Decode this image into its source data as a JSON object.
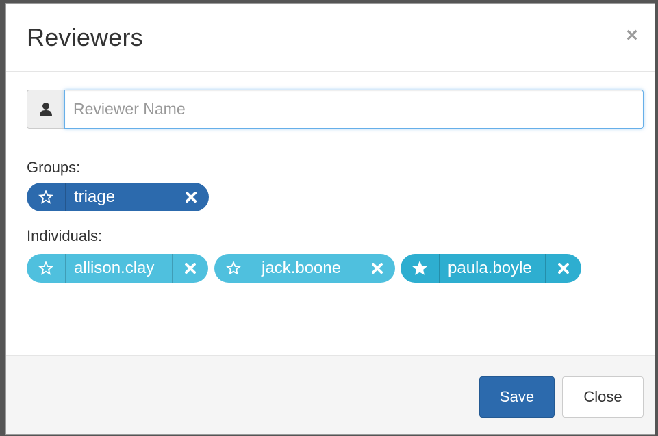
{
  "dialog": {
    "title": "Reviewers",
    "close_glyph": "×"
  },
  "search": {
    "placeholder": "Reviewer Name",
    "value": "",
    "icon": "user-icon"
  },
  "groups": {
    "label": "Groups:",
    "items": [
      {
        "name": "triage",
        "starred": false
      }
    ]
  },
  "individuals": {
    "label": "Individuals:",
    "items": [
      {
        "name": "allison.clay",
        "starred": false
      },
      {
        "name": "jack.boone",
        "starred": false
      },
      {
        "name": "paula.boyle",
        "starred": true
      }
    ]
  },
  "footer": {
    "save_label": "Save",
    "close_label": "Close"
  },
  "colors": {
    "group_pill": "#2c6aad",
    "individual_pill": "#4fc0de",
    "individual_pill_starred": "#2eaed0",
    "primary_button": "#2c6aad"
  }
}
